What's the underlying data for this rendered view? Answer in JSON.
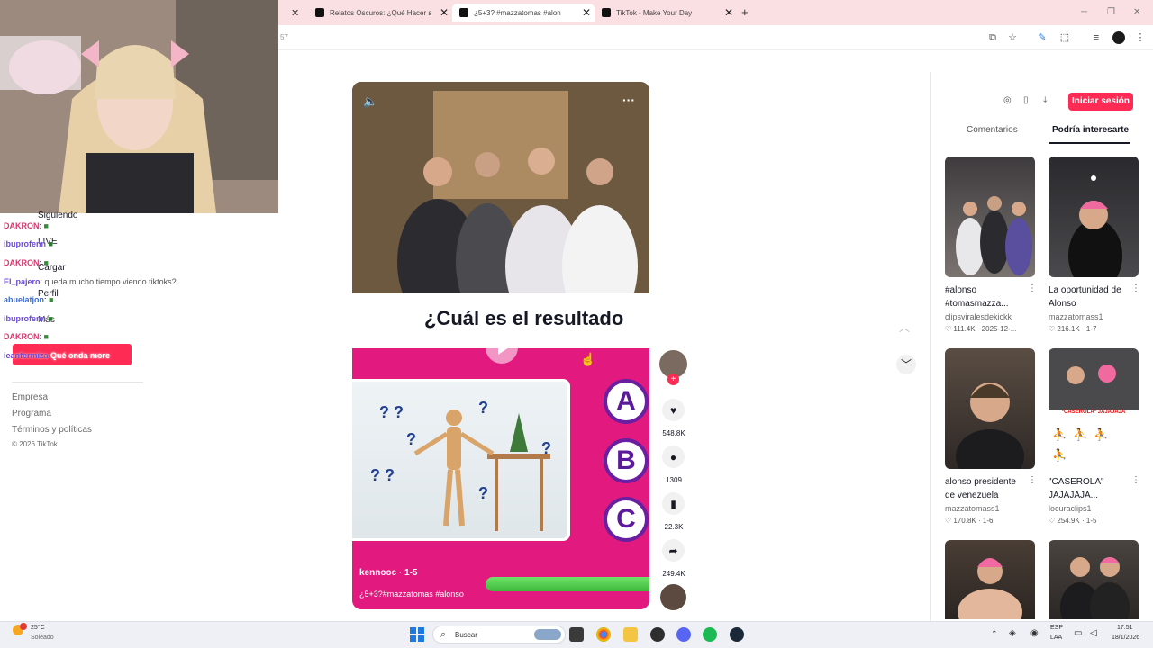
{
  "browser": {
    "tabs": [
      {
        "title": "Relatos Oscuros: ¿Qué Hacer s"
      },
      {
        "title": "¿5+3? #mazzatomas #alon"
      },
      {
        "title": "TikTok - Make Your Day"
      }
    ],
    "address_fragment": "57"
  },
  "chat": [
    {
      "user": "DAKRON",
      "msg": ":"
    },
    {
      "user": "ibuprofenn",
      "msg": ""
    },
    {
      "user": "DAKRON",
      "msg": ":"
    },
    {
      "user": "El_pajero",
      "msg": ": queda mucho tiempo viendo tiktoks?"
    },
    {
      "user": "abuelatjon",
      "msg": ":"
    },
    {
      "user": "ibuprofenn",
      "msg": ""
    },
    {
      "user": "DAKRON",
      "msg": ":"
    },
    {
      "user": "ieanfermiza",
      "msg": "Qué onda more"
    }
  ],
  "sidebar": {
    "items": [
      {
        "label": "Siguiendo"
      },
      {
        "label": "LIVE"
      },
      {
        "label": "Cargar"
      },
      {
        "label": "Perfil"
      },
      {
        "label": "Más"
      }
    ],
    "login_label": "Iniciar sesión",
    "footer": [
      "Empresa",
      "Programa",
      "Términos y políticas",
      "© 2026 TikTok"
    ]
  },
  "video": {
    "overlay_title": "¿Cuál es el resultado",
    "options": [
      "A",
      "B",
      "C"
    ],
    "author": "kennooc · 1-5",
    "description": "¿5+3?#mazzatomas #alonso",
    "actions": [
      {
        "name": "like",
        "count": "548.8K"
      },
      {
        "name": "comment",
        "count": "1309"
      },
      {
        "name": "save",
        "count": "22.3K"
      },
      {
        "name": "share",
        "count": "249.4K"
      }
    ]
  },
  "right_panel": {
    "login_button": "Iniciar sesión",
    "tabs": [
      {
        "label": "Comentarios"
      },
      {
        "label": "Podría interesarte"
      }
    ],
    "active_tab": 1,
    "cards": [
      {
        "caption_1": "#alonso",
        "caption_2": "#tomasmazza...",
        "author": "clipsviralesdekickk",
        "stats": "111.4K · 2025-12-..."
      },
      {
        "caption_1": "La oportunidad de",
        "caption_2": "Alonso",
        "author": "mazzatomass1",
        "stats": "216.1K · 1-7"
      },
      {
        "caption_1": "alonso presidente",
        "caption_2": "de venezuela",
        "author": "mazzatomass1",
        "stats": "170.8K · 1-6"
      },
      {
        "caption_1": "\"CASEROLA\"",
        "caption_2": "JAJAJAJA...",
        "author": "locuraclips1",
        "stats": "254.9K · 1-5"
      }
    ],
    "thumb_overlay_text": "*CASEROLA* JAJAJAJA"
  },
  "taskbar": {
    "weather_temp": "25°C",
    "weather_desc": "Soleado",
    "search_placeholder": "Buscar",
    "lang_1": "ESP",
    "lang_2": "LAA",
    "time": "17:51",
    "date": "18/1/2026"
  },
  "colors": {
    "brand_red": "#fe2c55",
    "quiz_pink": "#e2197e",
    "tab_strip": "#fbe0e3"
  }
}
